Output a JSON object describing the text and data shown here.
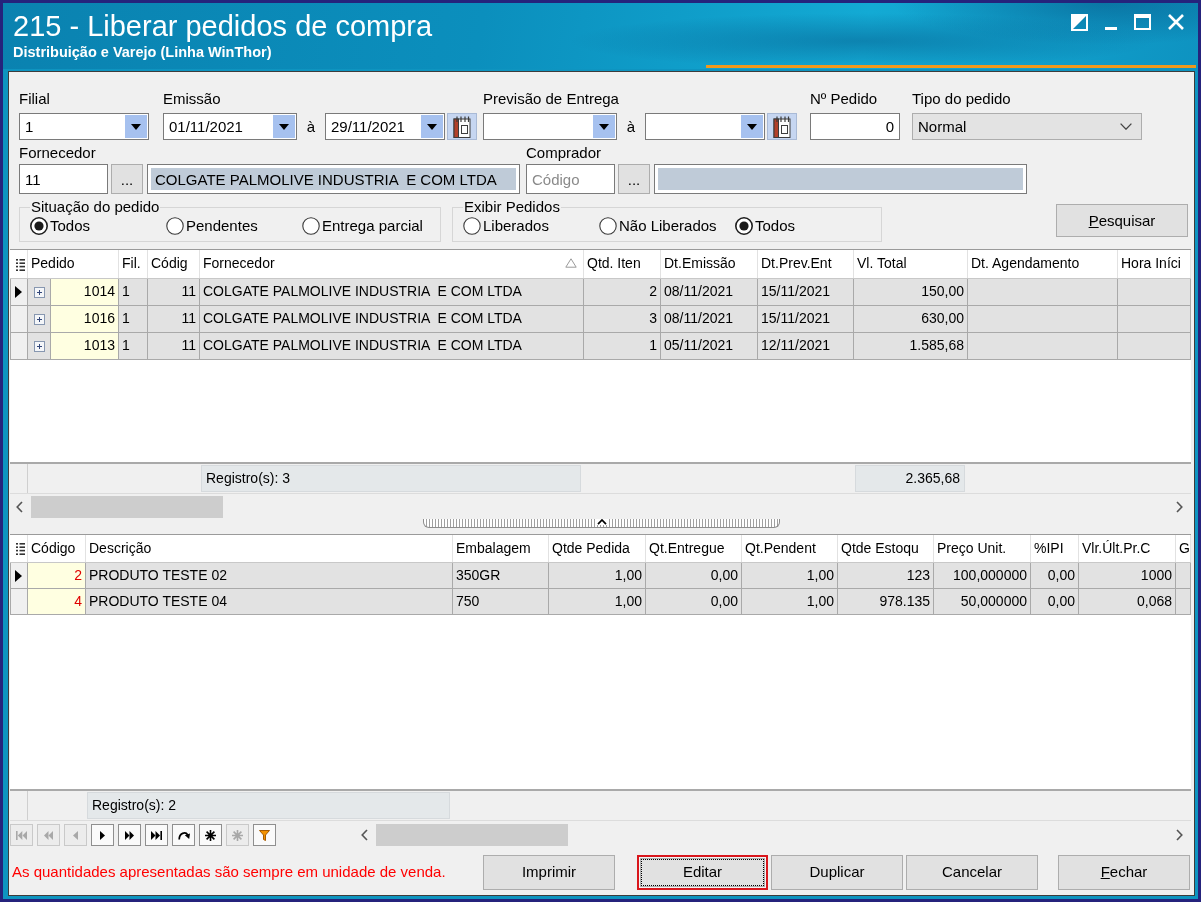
{
  "window": {
    "title": "215 - Liberar pedidos de compra",
    "subtitle": "Distribuição e Varejo (Linha WinThor)"
  },
  "filters": {
    "filial": {
      "label": "Filial",
      "value": "1"
    },
    "emissao": {
      "label": "Emissão",
      "from": "01/11/2021",
      "separator": "à",
      "to": "29/11/2021"
    },
    "previsao_entrega": {
      "label": "Previsão de Entrega",
      "separator": "à"
    },
    "numero_pedido": {
      "label": "Nº Pedido",
      "value": "0"
    },
    "tipo_pedido": {
      "label": "Tipo do pedido",
      "value": "Normal"
    },
    "fornecedor": {
      "label": "Fornecedor",
      "code": "11",
      "lookup_button": "...",
      "name": "COLGATE PALMOLIVE INDUSTRIA  E COM LTDA"
    },
    "comprador": {
      "label": "Comprador",
      "placeholder": "Código",
      "lookup_button": "..."
    },
    "situacao_pedido": {
      "title": "Situação do pedido",
      "options": [
        {
          "label": "Todos",
          "selected": true
        },
        {
          "label": "Pendentes",
          "selected": false
        },
        {
          "label": "Entrega parcial",
          "selected": false
        }
      ]
    },
    "exibir_pedidos": {
      "title": "Exibir Pedidos",
      "options": [
        {
          "label": "Liberados",
          "selected": false
        },
        {
          "label": "Não Liberados",
          "selected": false
        },
        {
          "label": "Todos",
          "selected": true
        }
      ]
    },
    "search_button": {
      "label": "Pesquisar",
      "mnemonic": true
    }
  },
  "orders_grid": {
    "columns": [
      {
        "label": "Pedido",
        "sorted": false
      },
      {
        "label": "Fil.",
        "sorted": false
      },
      {
        "label": "Códig",
        "sorted": false
      },
      {
        "label": "Fornecedor",
        "sorted": true
      },
      {
        "label": "Qtd. Iten",
        "sorted": false
      },
      {
        "label": "Dt.Emissão",
        "sorted": false
      },
      {
        "label": "Dt.Prev.Ent",
        "sorted": false
      },
      {
        "label": "Vl. Total",
        "sorted": false
      },
      {
        "label": "Dt. Agendamento",
        "sorted": false
      },
      {
        "label": "Hora Iníci",
        "sorted": false
      }
    ],
    "rows": [
      {
        "selected": true,
        "expanded": false,
        "cells": [
          "1014",
          "1",
          "11",
          "COLGATE PALMOLIVE INDUSTRIA  E COM LTDA",
          "2",
          "08/11/2021",
          "15/11/2021",
          "150,00"
        ]
      },
      {
        "selected": false,
        "expanded": false,
        "cells": [
          "1016",
          "1",
          "11",
          "COLGATE PALMOLIVE INDUSTRIA  E COM LTDA",
          "3",
          "08/11/2021",
          "15/11/2021",
          "630,00"
        ]
      },
      {
        "selected": false,
        "expanded": false,
        "cells": [
          "1013",
          "1",
          "11",
          "COLGATE PALMOLIVE INDUSTRIA  E COM LTDA",
          "1",
          "05/11/2021",
          "12/11/2021",
          "1.585,68"
        ]
      }
    ],
    "footer": {
      "count": "Registro(s): 3",
      "total": "2.365,68"
    }
  },
  "items_grid": {
    "columns": [
      "Código",
      "Descrição",
      "Embalagem",
      "Qtde Pedida",
      "Qt.Entregue",
      "Qt.Pendent",
      "Qtde Estoqu",
      "Preço Unit.",
      "%IPI",
      "Vlr.Últ.Pr.C",
      "G"
    ],
    "rows": [
      {
        "selected": true,
        "cells": [
          "2",
          "PRODUTO TESTE 02",
          "350GR",
          "1,00",
          "0,00",
          "1,00",
          "123",
          "100,000000",
          "0,00",
          "1000"
        ]
      },
      {
        "selected": false,
        "cells": [
          "4",
          "PRODUTO TESTE 04",
          "750",
          "1,00",
          "0,00",
          "1,00",
          "978.135",
          "50,000000",
          "0,00",
          "0,068"
        ]
      }
    ],
    "footer": {
      "count": "Registro(s): 2"
    }
  },
  "navigator": {
    "buttons": [
      {
        "kind": "first",
        "disabled": true
      },
      {
        "kind": "prior_page",
        "disabled": true
      },
      {
        "kind": "prior",
        "disabled": true
      },
      {
        "kind": "next",
        "disabled": false
      },
      {
        "kind": "next_page",
        "disabled": false
      },
      {
        "kind": "last",
        "disabled": false
      },
      {
        "kind": "refresh",
        "disabled": false
      },
      {
        "kind": "asterisk",
        "disabled": false
      },
      {
        "kind": "asterisk",
        "disabled": true
      },
      {
        "kind": "filter",
        "disabled": false
      }
    ]
  },
  "status_message": "As quantidades apresentadas são sempre em unidade de venda.",
  "buttons": [
    {
      "label": "Imprimir",
      "mnemonic": false,
      "focused": false,
      "highlighted": false
    },
    {
      "label": "Editar",
      "mnemonic": false,
      "focused": true,
      "highlighted": true
    },
    {
      "label": "Duplicar",
      "mnemonic": false,
      "focused": false,
      "highlighted": false
    },
    {
      "label": "Cancelar",
      "mnemonic": false,
      "focused": false,
      "highlighted": false
    },
    {
      "label": "Fechar",
      "mnemonic": true,
      "focused": false,
      "highlighted": false
    }
  ]
}
